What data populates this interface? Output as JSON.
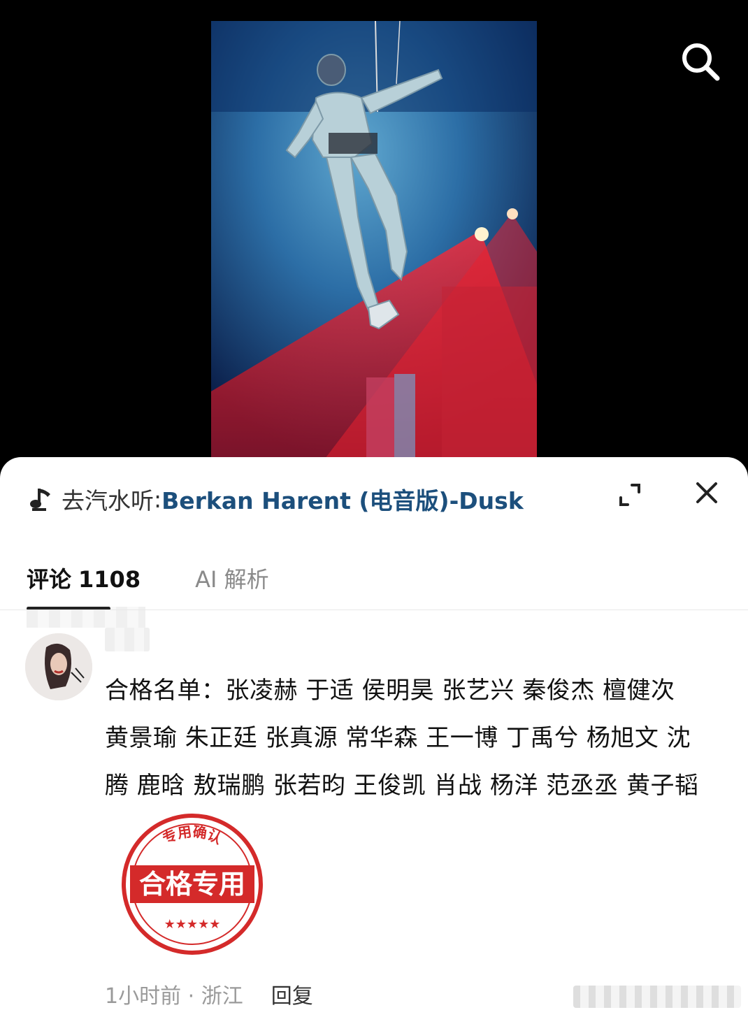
{
  "video": {
    "description_icon": "video-thumbnail"
  },
  "toolbar": {
    "search_icon": "search-icon"
  },
  "music": {
    "prefix": "去汽水听",
    "separator": ":",
    "song": "Berkan Harent (电音版)-Dusk",
    "link_color": "#1c4f7c"
  },
  "tabs": {
    "comments_label": "评论",
    "comments_count": "1108",
    "ai_label": "AI 解析"
  },
  "comment": {
    "lines": [
      "合格名单：张凌赫 于适 侯明昊 张艺兴  秦俊杰 檀健次",
      "黄景瑜 朱正廷 张真源 常华森 王一博 丁禹兮 杨旭文 沈",
      "腾 鹿晗 敖瑞鹏 张若昀 王俊凯 肖战 杨洋 范丞丞 黄子韬"
    ],
    "stamp": {
      "top_text": "专用确认",
      "main_text": "合格专用",
      "stars": "★★★★★",
      "color": "#d42a2a"
    },
    "time_location": "1小时前 · 浙江",
    "reply_label": "回复"
  }
}
